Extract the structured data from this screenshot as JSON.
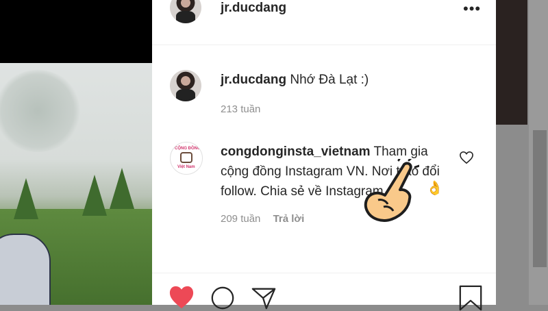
{
  "post": {
    "author": "jr.ducdang",
    "caption": "Nhớ Đà Lạt :)",
    "caption_age": "213 tuần"
  },
  "comment": {
    "author": "congdonginsta_vietnam",
    "text": "Tham gia cộng đồng Instagram VN. Nơi trao đổi follow. Chia sẻ về Instagram",
    "emoji": "👌",
    "age": "209 tuần",
    "reply_label": "Trả lời",
    "avatar_top": "CỘNG ĐỒNG",
    "avatar_bottom": "Việt Nam"
  },
  "icons": {
    "more": "•••",
    "heart": "heart-icon",
    "comment": "comment-icon",
    "share": "share-icon",
    "save": "bookmark-icon"
  },
  "colors": {
    "like_red": "#ed4956",
    "text": "#262626",
    "muted": "#8e8e8e"
  }
}
